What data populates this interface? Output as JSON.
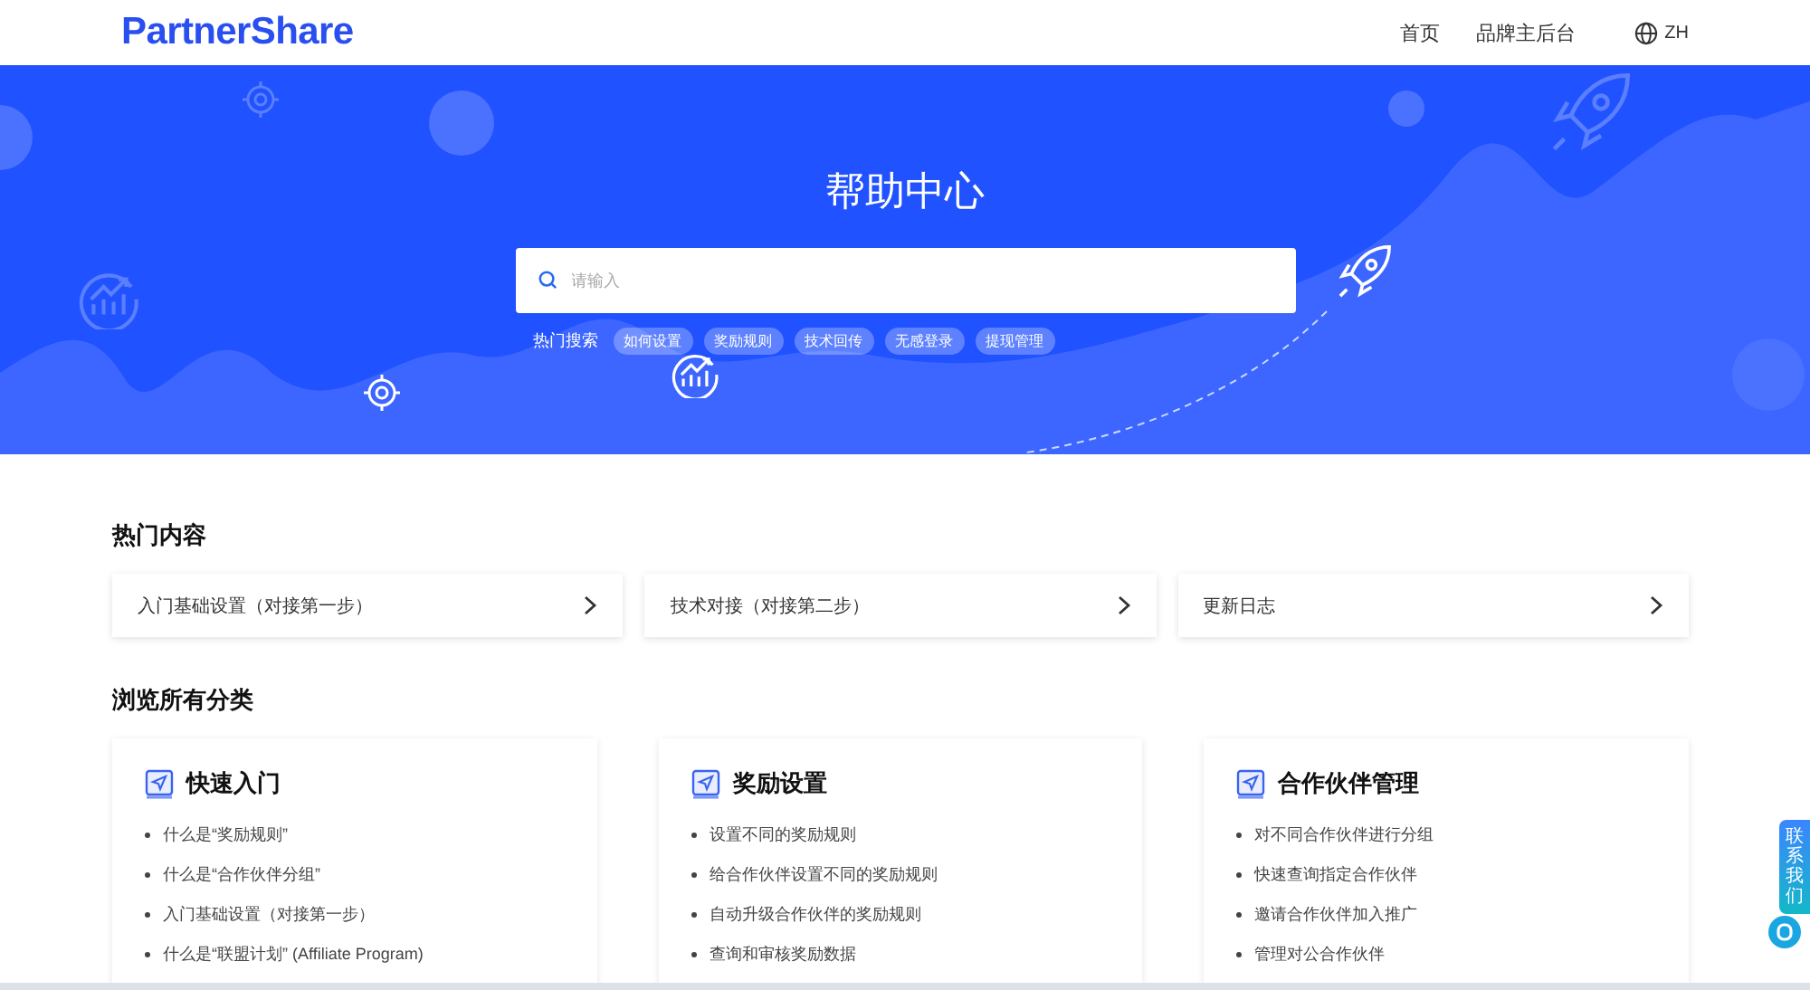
{
  "header": {
    "logo": "PartnerShare",
    "nav": [
      {
        "label": "首页"
      },
      {
        "label": "品牌主后台"
      }
    ],
    "language": "ZH"
  },
  "hero": {
    "title": "帮助中心",
    "search": {
      "placeholder": "请输入"
    },
    "hot_label": "热门搜索",
    "hot_tags": [
      "如何设置",
      "奖励规则",
      "技术回传",
      "无感登录",
      "提现管理"
    ]
  },
  "popular": {
    "heading": "热门内容",
    "items": [
      "入门基础设置（对接第一步）",
      "技术对接（对接第二步）",
      "更新日志"
    ]
  },
  "categories": {
    "heading": "浏览所有分类",
    "items": [
      {
        "title": "快速入门",
        "links": [
          "什么是“奖励规则”",
          "什么是“合作伙伴分组”",
          "入门基础设置（对接第一步）",
          "什么是“联盟计划” (Affiliate Program)"
        ]
      },
      {
        "title": "奖励设置",
        "links": [
          "设置不同的奖励规则",
          "给合作伙伴设置不同的奖励规则",
          "自动升级合作伙伴的奖励规则",
          "查询和审核奖励数据"
        ]
      },
      {
        "title": "合作伙伴管理",
        "links": [
          "对不同合作伙伴进行分组",
          "快速查询指定合作伙伴",
          "邀请合作伙伴加入推广",
          "管理对公合作伙伴"
        ]
      }
    ]
  },
  "contact_tab": {
    "label": "联系我们"
  }
}
